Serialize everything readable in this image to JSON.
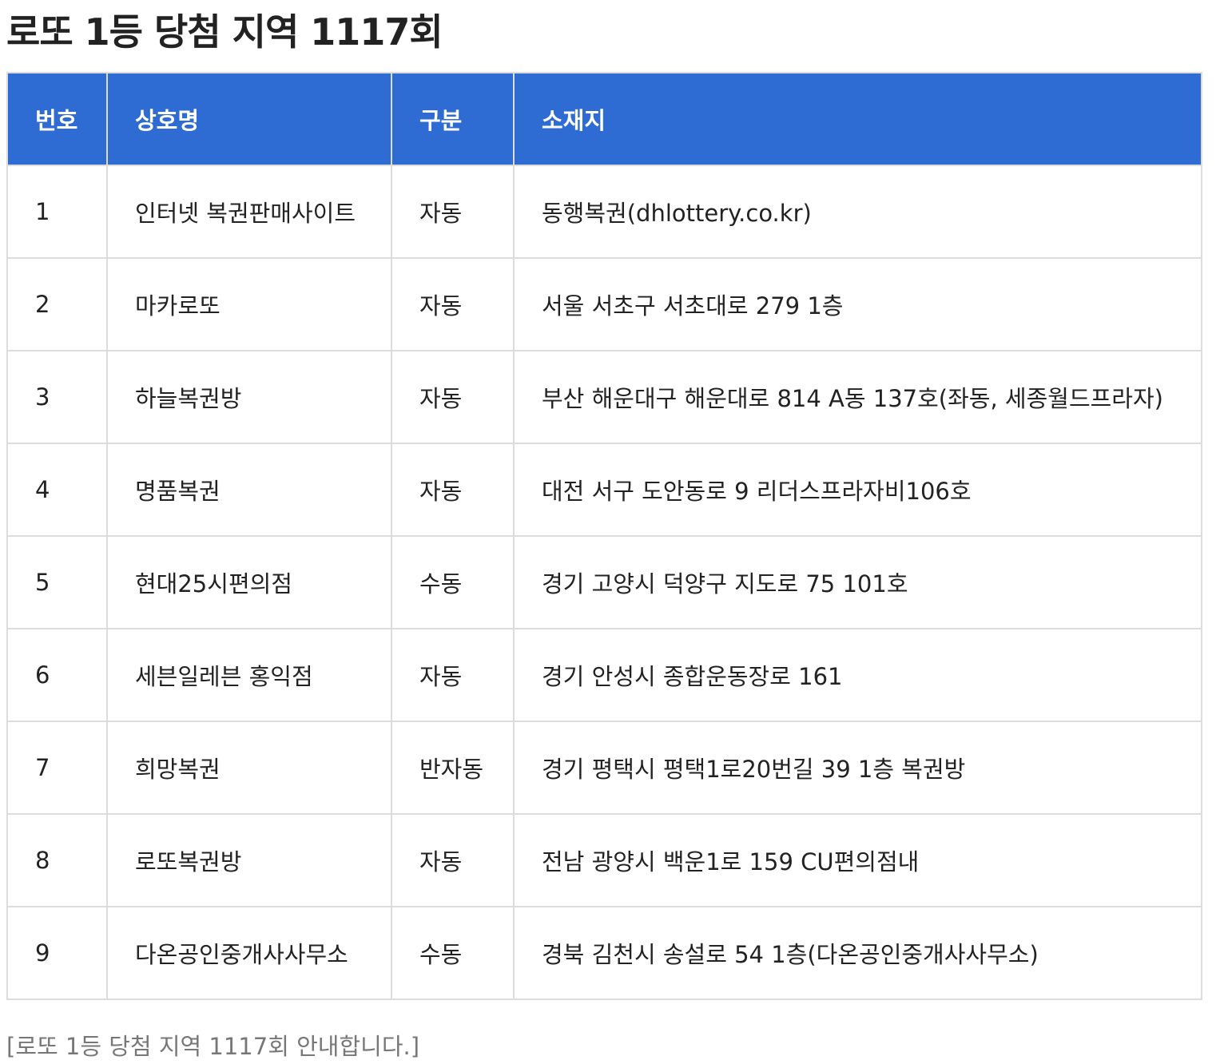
{
  "title": "로또 1등 당첨 지역 1117회",
  "table": {
    "headers": {
      "no": "번호",
      "name": "상호명",
      "type": "구분",
      "address": "소재지"
    },
    "rows": [
      {
        "no": "1",
        "name": "인터넷 복권판매사이트",
        "type": "자동",
        "address": "동행복권(dhlottery.co.kr)"
      },
      {
        "no": "2",
        "name": "마카로또",
        "type": "자동",
        "address": "서울 서초구 서초대로 279 1층"
      },
      {
        "no": "3",
        "name": "하늘복권방",
        "type": "자동",
        "address": "부산 해운대구 해운대로 814 A동 137호(좌동, 세종월드프라자)"
      },
      {
        "no": "4",
        "name": "명품복권",
        "type": "자동",
        "address": "대전 서구 도안동로 9 리더스프라자비106호"
      },
      {
        "no": "5",
        "name": "현대25시편의점",
        "type": "수동",
        "address": "경기 고양시 덕양구 지도로 75 101호"
      },
      {
        "no": "6",
        "name": "세븐일레븐 홍익점",
        "type": "자동",
        "address": "경기 안성시 종합운동장로 161"
      },
      {
        "no": "7",
        "name": "희망복권",
        "type": "반자동",
        "address": "경기 평택시 평택1로20번길 39 1층 복권방"
      },
      {
        "no": "8",
        "name": "로또복권방",
        "type": "자동",
        "address": "전남 광양시 백운1로 159 CU편의점내"
      },
      {
        "no": "9",
        "name": "다온공인중개사사무소",
        "type": "수동",
        "address": "경북 김천시 송설로 54 1층(다온공인중개사사무소)"
      }
    ]
  },
  "caption": "[로또 1등 당첨 지역 1117회 안내합니다.]",
  "colors": {
    "header_bg": "#2e6bd2",
    "header_text": "#ffffff",
    "border": "#dcdcdc",
    "caption_text": "#777777"
  }
}
